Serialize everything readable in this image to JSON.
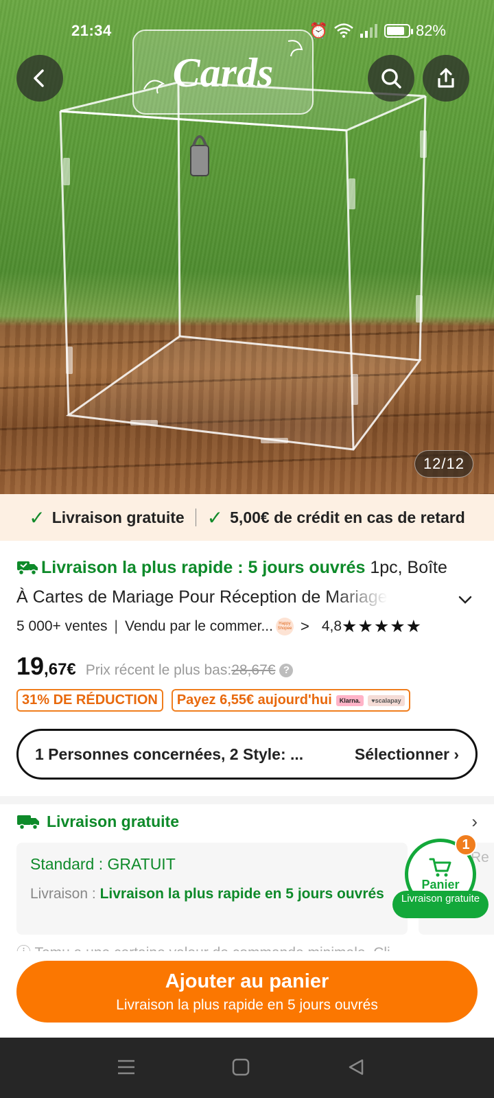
{
  "status_bar": {
    "time": "21:34",
    "battery": "82%",
    "battery_level": 0.82
  },
  "hero": {
    "sign_text": "Cards",
    "image_counter": "12/12",
    "back_icon": "chevron-left-icon",
    "search_icon": "search-icon",
    "share_icon": "share-icon"
  },
  "promo": {
    "item1": "Livraison gratuite",
    "item2": "5,00€ de crédit en cas de retard"
  },
  "product": {
    "fast_delivery": "Livraison la plus rapide : 5 jours ouvrés",
    "title_line1": "1pc, Boîte",
    "title_line2": "À Cartes de Mariage Pour Réception de Mariage",
    "sales": "5 000+ ventes",
    "seller": "Vendu par le commer...",
    "seller_badge": "Happy Shopee",
    "rating": "4,8",
    "stars": "★★★★★",
    "price_int": "19",
    "price_dec": ",67€",
    "recent_label": "Prix récent le plus bas:",
    "recent_price": "28,67€",
    "discount_badge": "31% DE RÉDUCTION",
    "pay_today": "Payez 6,55€ aujourd'hui",
    "klarna": "Klarna.",
    "scalapay": "♥scalapay"
  },
  "selector": {
    "value": "1 Personnes concernées, 2 Style: ...",
    "action": "Sélectionner"
  },
  "delivery": {
    "header": "Livraison gratuite",
    "standard": "Standard : GRATUIT",
    "label": "Livraison :",
    "detail": "Livraison la plus rapide en 5 jours ouvrés",
    "next_card_peek": "Re",
    "note": "Temu a une certaine valeur de commande minimale. Cli..."
  },
  "cart": {
    "count": "1",
    "label": "Panier",
    "pill": "Livraison gratuite"
  },
  "cta": {
    "main": "Ajouter au panier",
    "sub": "Livraison la plus rapide en 5 jours ouvrés"
  },
  "colors": {
    "accent_orange": "#fb7701",
    "green": "#0e8a2a",
    "promo_bg": "#fdf0e3"
  }
}
